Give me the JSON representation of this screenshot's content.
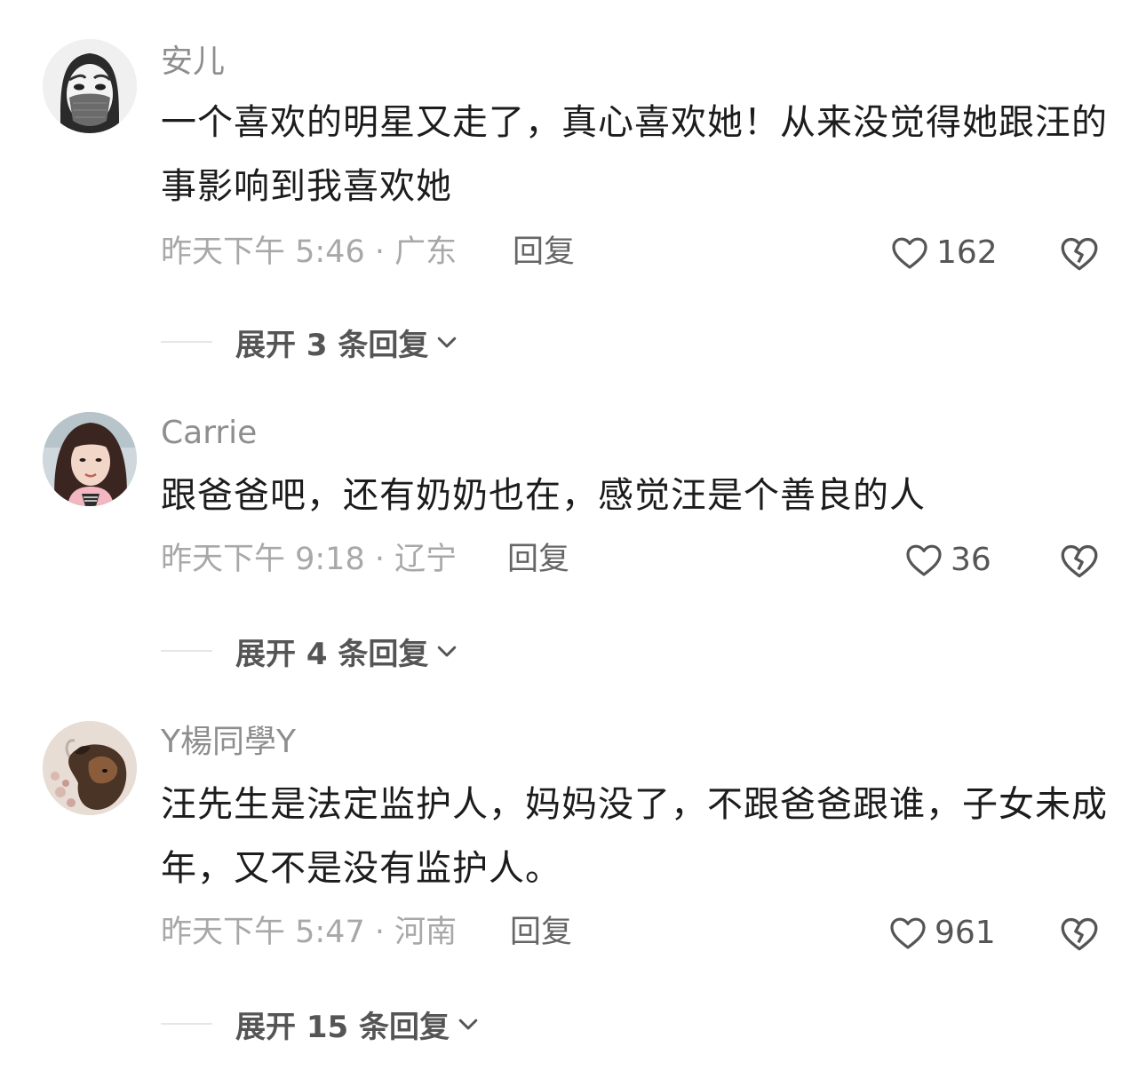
{
  "comments": [
    {
      "username": "安儿",
      "text": "一个喜欢的明星又走了，真心喜欢她！从来没觉得她跟汪的事影响到我喜欢她",
      "meta": "昨天下午 5:46 · 广东",
      "reply_label": "回复",
      "likes": "162",
      "expand_label": "展开 3 条回复",
      "avatar_icon": "masked-face-avatar"
    },
    {
      "username": "Carrie",
      "text": "跟爸爸吧，还有奶奶也在，感觉汪是个善良的人",
      "meta": "昨天下午 9:18 · 辽宁",
      "reply_label": "回复",
      "likes": "36",
      "expand_label": "展开 4 条回复",
      "avatar_icon": "woman-photo-avatar"
    },
    {
      "username": "Y楊同學Y",
      "text": "汪先生是法定监护人，妈妈没了，不跟爸爸跟谁，子女未成年，又不是没有监护人。",
      "meta": "昨天下午 5:47 · 河南",
      "reply_label": "回复",
      "likes": "961",
      "expand_label": "展开 15 条回复",
      "avatar_icon": "dog-photo-avatar"
    }
  ],
  "colors": {
    "meta": "#a8a8a8",
    "username": "#8e8e8e",
    "text": "#1c1c1c",
    "icon": "#555555"
  }
}
